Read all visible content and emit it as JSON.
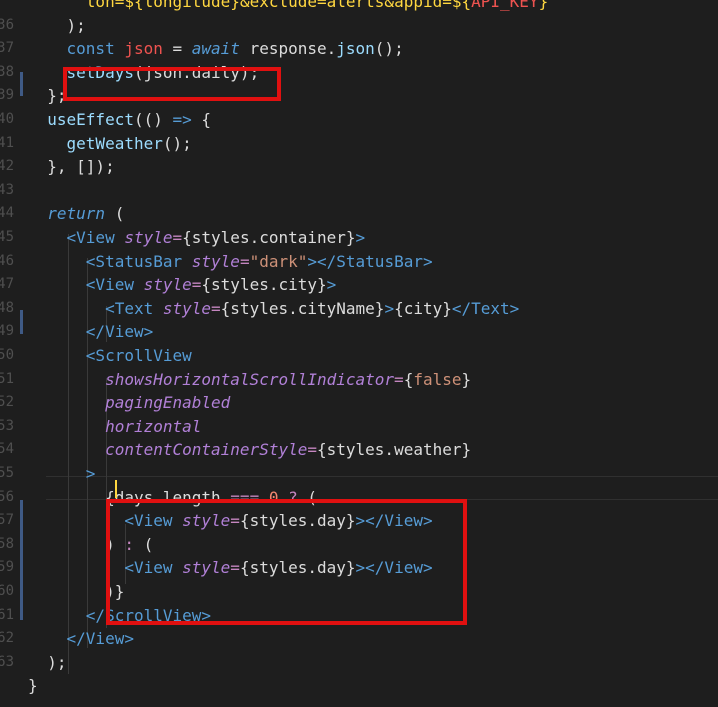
{
  "gutter_numbers": [
    "",
    "36",
    "37",
    "38",
    "39",
    "40",
    "41",
    "42",
    "43",
    "44",
    "45",
    "46",
    "47",
    "48",
    "49",
    "50",
    "51",
    "52",
    "53",
    "54",
    "55",
    "56",
    "57",
    "58",
    "59",
    "60",
    "61",
    "62",
    "63",
    ""
  ],
  "lines": [
    [
      {
        "t": "      ",
        "c": "id"
      },
      {
        "t": "lon=",
        "c": "yel"
      },
      {
        "t": "${",
        "c": "yel"
      },
      {
        "t": "longitude",
        "c": "yel"
      },
      {
        "t": "}",
        "c": "yel"
      },
      {
        "t": "&exclude=alerts&appid=",
        "c": "yel"
      },
      {
        "t": "${",
        "c": "yel"
      },
      {
        "t": "API_KEY",
        "c": "var"
      },
      {
        "t": "}",
        "c": "yel"
      },
      {
        "t": "`",
        "c": "yel"
      }
    ],
    [
      {
        "t": "    );",
        "c": "punct"
      }
    ],
    [
      {
        "t": "    ",
        "c": "id"
      },
      {
        "t": "const ",
        "c": "kw"
      },
      {
        "t": "json ",
        "c": "var"
      },
      {
        "t": "= ",
        "c": "punct"
      },
      {
        "t": "await ",
        "c": "kwi"
      },
      {
        "t": "response",
        "c": "id"
      },
      {
        "t": ".",
        "c": "punct"
      },
      {
        "t": "json",
        "c": "fn"
      },
      {
        "t": "();",
        "c": "punct"
      }
    ],
    [
      {
        "t": "    ",
        "c": "id"
      },
      {
        "t": "setDays",
        "c": "fn"
      },
      {
        "t": "(json.daily);",
        "c": "id"
      }
    ],
    [
      {
        "t": "  };",
        "c": "punct"
      }
    ],
    [
      {
        "t": "  ",
        "c": "id"
      },
      {
        "t": "useEffect",
        "c": "fn"
      },
      {
        "t": "(() ",
        "c": "punct"
      },
      {
        "t": "=> ",
        "c": "kw"
      },
      {
        "t": "{",
        "c": "punct"
      }
    ],
    [
      {
        "t": "    ",
        "c": "id"
      },
      {
        "t": "getWeather",
        "c": "fn"
      },
      {
        "t": "();",
        "c": "punct"
      }
    ],
    [
      {
        "t": "  }, []);",
        "c": "punct"
      }
    ],
    [
      {
        "t": "",
        "c": "id"
      }
    ],
    [
      {
        "t": "  ",
        "c": "id"
      },
      {
        "t": "return ",
        "c": "kwi"
      },
      {
        "t": "(",
        "c": "punct"
      }
    ],
    [
      {
        "t": "    ",
        "c": "id"
      },
      {
        "t": "<View ",
        "c": "tag"
      },
      {
        "t": "style",
        "c": "attr"
      },
      {
        "t": "=",
        "c": "eq"
      },
      {
        "t": "{styles.container}",
        "c": "id"
      },
      {
        "t": ">",
        "c": "tag"
      }
    ],
    [
      {
        "t": "      ",
        "c": "id"
      },
      {
        "t": "<StatusBar ",
        "c": "tag"
      },
      {
        "t": "style",
        "c": "attr"
      },
      {
        "t": "=",
        "c": "eq"
      },
      {
        "t": "\"dark\"",
        "c": "str"
      },
      {
        "t": "></StatusBar>",
        "c": "tag"
      }
    ],
    [
      {
        "t": "      ",
        "c": "id"
      },
      {
        "t": "<View ",
        "c": "tag"
      },
      {
        "t": "style",
        "c": "attr"
      },
      {
        "t": "=",
        "c": "eq"
      },
      {
        "t": "{styles.city}",
        "c": "id"
      },
      {
        "t": ">",
        "c": "tag"
      }
    ],
    [
      {
        "t": "        ",
        "c": "id"
      },
      {
        "t": "<Text ",
        "c": "tag"
      },
      {
        "t": "style",
        "c": "attr"
      },
      {
        "t": "=",
        "c": "eq"
      },
      {
        "t": "{styles.cityName}",
        "c": "id"
      },
      {
        "t": ">",
        "c": "tag"
      },
      {
        "t": "{city}",
        "c": "id"
      },
      {
        "t": "</Text>",
        "c": "tag"
      }
    ],
    [
      {
        "t": "      ",
        "c": "id"
      },
      {
        "t": "</View>",
        "c": "tag"
      }
    ],
    [
      {
        "t": "      ",
        "c": "id"
      },
      {
        "t": "<ScrollView",
        "c": "tag"
      }
    ],
    [
      {
        "t": "        ",
        "c": "id"
      },
      {
        "t": "showsHorizontalScrollIndicator",
        "c": "attr"
      },
      {
        "t": "=",
        "c": "eq"
      },
      {
        "t": "{",
        "c": "punct"
      },
      {
        "t": "false",
        "c": "bool"
      },
      {
        "t": "}",
        "c": "punct"
      }
    ],
    [
      {
        "t": "        ",
        "c": "id"
      },
      {
        "t": "pagingEnabled",
        "c": "attr"
      }
    ],
    [
      {
        "t": "        ",
        "c": "id"
      },
      {
        "t": "horizontal",
        "c": "attr"
      }
    ],
    [
      {
        "t": "        ",
        "c": "id"
      },
      {
        "t": "contentContainerStyle",
        "c": "attr"
      },
      {
        "t": "=",
        "c": "eq"
      },
      {
        "t": "{styles.weather}",
        "c": "id"
      }
    ],
    [
      {
        "t": "      ",
        "c": "id"
      },
      {
        "t": ">",
        "c": "tag"
      }
    ],
    [
      {
        "t": "        ",
        "c": "id"
      },
      {
        "t": "{days.length ",
        "c": "id"
      },
      {
        "t": "=== ",
        "c": "eq"
      },
      {
        "t": "0 ",
        "c": "num"
      },
      {
        "t": "? ",
        "c": "eq"
      },
      {
        "t": "(",
        "c": "punct"
      }
    ],
    [
      {
        "t": "          ",
        "c": "id"
      },
      {
        "t": "<View ",
        "c": "tag"
      },
      {
        "t": "style",
        "c": "attr"
      },
      {
        "t": "=",
        "c": "eq"
      },
      {
        "t": "{styles.day}",
        "c": "id"
      },
      {
        "t": "></View>",
        "c": "tag"
      }
    ],
    [
      {
        "t": "        ",
        "c": "id"
      },
      {
        "t": ") ",
        "c": "punct"
      },
      {
        "t": ": ",
        "c": "eq"
      },
      {
        "t": "(",
        "c": "punct"
      }
    ],
    [
      {
        "t": "          ",
        "c": "id"
      },
      {
        "t": "<View ",
        "c": "tag"
      },
      {
        "t": "style",
        "c": "attr"
      },
      {
        "t": "=",
        "c": "eq"
      },
      {
        "t": "{styles.day}",
        "c": "id"
      },
      {
        "t": "></View>",
        "c": "tag"
      }
    ],
    [
      {
        "t": "        ",
        "c": "id"
      },
      {
        "t": ")}",
        "c": "punct"
      }
    ],
    [
      {
        "t": "      ",
        "c": "id"
      },
      {
        "t": "</ScrollView>",
        "c": "tag"
      }
    ],
    [
      {
        "t": "    ",
        "c": "id"
      },
      {
        "t": "</View>",
        "c": "tag"
      }
    ],
    [
      {
        "t": "  );",
        "c": "punct"
      }
    ],
    [
      {
        "t": "}",
        "c": "punct"
      }
    ]
  ]
}
